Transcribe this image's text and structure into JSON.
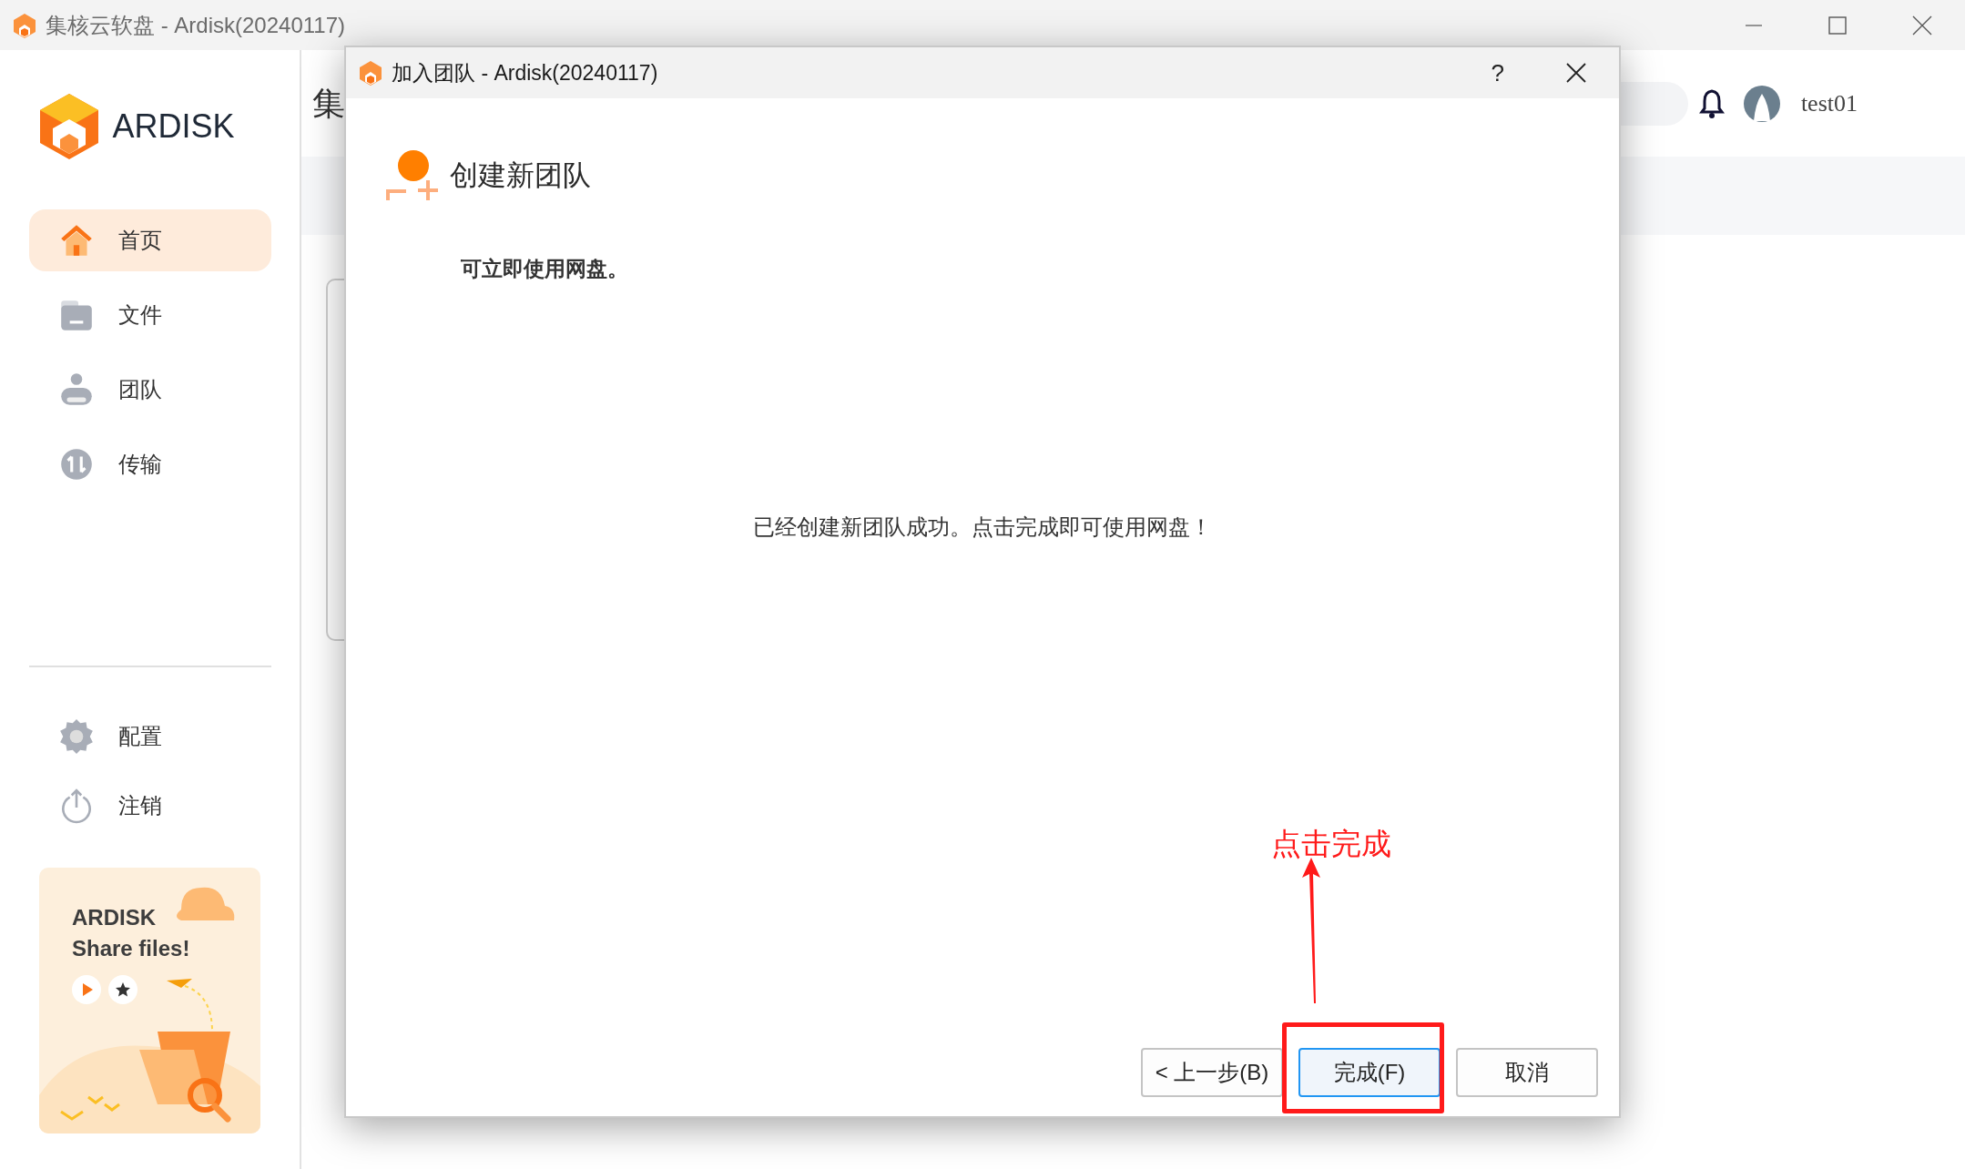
{
  "app_window": {
    "title": "集核云软盘 - Ardisk(20240117)"
  },
  "sidebar": {
    "logo": "ARDISK",
    "items": [
      {
        "label": "首页",
        "kind": "home",
        "selected": true
      },
      {
        "label": "文件",
        "kind": "folder",
        "selected": false
      },
      {
        "label": "团队",
        "kind": "team",
        "selected": false
      },
      {
        "label": "传输",
        "kind": "transfer",
        "selected": false
      }
    ],
    "bottom_items": [
      {
        "label": "配置",
        "kind": "gear"
      },
      {
        "label": "注销",
        "kind": "power"
      }
    ],
    "banner": {
      "title": "ARDISK",
      "subtitle": "Share files!"
    }
  },
  "header": {
    "page_title": "集",
    "user": "test01"
  },
  "dialog": {
    "title": "加入团队 - Ardisk(20240117)",
    "help": "?",
    "heading": "创建新团队",
    "subheading": "可立即使用网盘。",
    "message": "已经创建新团队成功。点击完成即可使用网盘！",
    "buttons": [
      {
        "label": "< 上一步(B)",
        "default": false
      },
      {
        "label": "完成(F)",
        "default": true
      },
      {
        "label": "取消",
        "default": false
      }
    ]
  },
  "annotation": {
    "text": "点击完成"
  }
}
